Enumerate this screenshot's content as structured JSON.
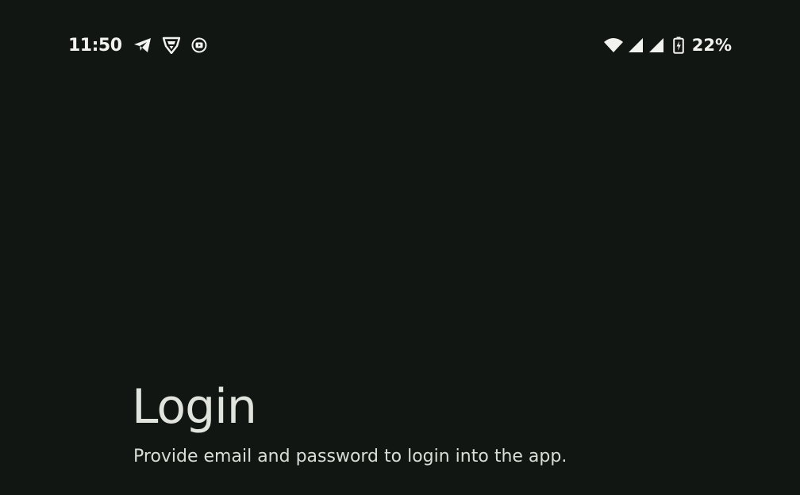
{
  "status_bar": {
    "time": "11:50",
    "left_icons": [
      "telegram-icon",
      "vpn-shield-icon",
      "media-notification-icon"
    ],
    "right_icons": [
      "wifi-icon",
      "cell-signal-icon",
      "cell-signal-icon",
      "battery-charging-icon"
    ],
    "battery_percent": "22%"
  },
  "login": {
    "title": "Login",
    "subtitle": "Provide email and password to login into the app."
  },
  "colors": {
    "background": "#111612",
    "text_primary": "#E1E4DD",
    "status_text": "#F2F2EE"
  }
}
